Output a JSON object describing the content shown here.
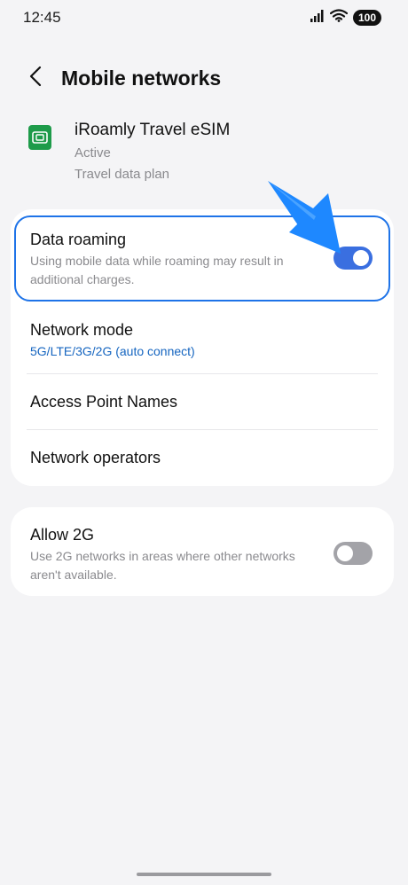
{
  "status_bar": {
    "time": "12:45",
    "battery": "100",
    "icons": [
      "signal-icon",
      "wifi-icon",
      "battery-icon"
    ]
  },
  "header": {
    "back_icon": "chevron-left-icon",
    "title": "Mobile networks"
  },
  "sim": {
    "icon": "sim-card-icon",
    "icon_color": "#1e9b4a",
    "name": "iRoamly Travel eSIM",
    "status": "Active",
    "plan": "Travel data plan"
  },
  "settings": {
    "data_roaming": {
      "title": "Data roaming",
      "description": "Using mobile data while roaming may result in additional charges.",
      "enabled": true
    },
    "network_mode": {
      "title": "Network mode",
      "value": "5G/LTE/3G/2G (auto connect)"
    },
    "access_point_names": {
      "title": "Access Point Names"
    },
    "network_operators": {
      "title": "Network operators"
    },
    "allow_2g": {
      "title": "Allow 2G",
      "description": "Use 2G networks in areas where other networks aren't available.",
      "enabled": false
    }
  },
  "colors": {
    "accent": "#3a6fe0",
    "highlight": "#1e73e8",
    "link": "#1565c0",
    "toggle_off": "#a3a3a8"
  }
}
